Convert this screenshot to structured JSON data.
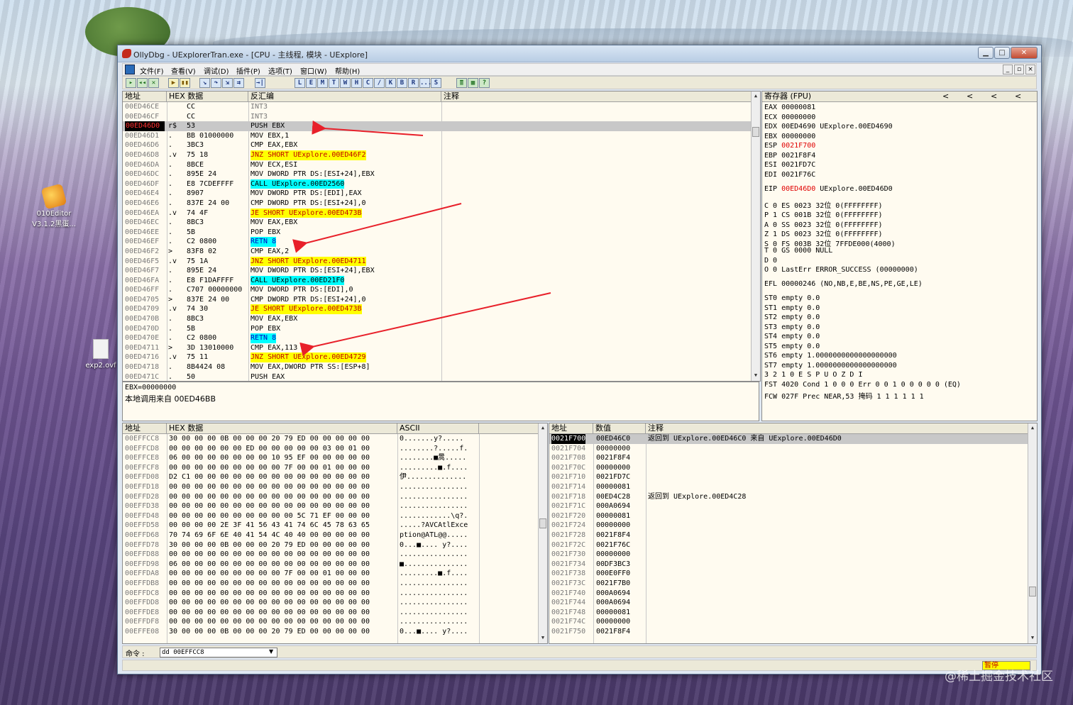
{
  "desktop": {
    "icons": [
      {
        "label_line1": "010Editor",
        "label_line2": "V3.1.2黑蛋..."
      },
      {
        "label_line1": "exp2.ovf",
        "label_line2": ""
      }
    ],
    "watermark": "@稀土掘金技术社区"
  },
  "window": {
    "title": "OllyDbg - UExplorerTran.exe - [CPU - 主线程, 模块 - UExplore]",
    "buttons": {
      "minimize": "▁",
      "maximize": "□",
      "close": "✕"
    },
    "menu": [
      "文件(F)",
      "查看(V)",
      "调试(D)",
      "插件(P)",
      "选项(T)",
      "窗口(W)",
      "帮助(H)"
    ],
    "mdi_buttons": [
      "_",
      "▫",
      "×"
    ],
    "toolbar": [
      "▸",
      "◂◂",
      "✕",
      "▶",
      "▮▮",
      "↘",
      "↷",
      "⇲",
      "⇉",
      "→|",
      "L",
      "E",
      "M",
      "T",
      "W",
      "H",
      "C",
      "/",
      "K",
      "B",
      "R",
      "...",
      "S",
      "≣",
      "▦",
      "?"
    ]
  },
  "cpu": {
    "headers": {
      "address": "地址",
      "hex": "HEX 数据",
      "disasm": "反汇编",
      "comment": "注释"
    },
    "rows": [
      {
        "addr": "00ED46CE",
        "mark": "",
        "hex": "CC",
        "asm": "INT3",
        "style": "dim"
      },
      {
        "addr": "00ED46CF",
        "mark": "",
        "hex": "CC",
        "asm": "INT3",
        "style": "dim"
      },
      {
        "addr": "00ED46D0",
        "mark": "r$",
        "hex": "53",
        "asm": "PUSH EBX",
        "style": "eip"
      },
      {
        "addr": "00ED46D1",
        "mark": ".",
        "hex": "BB 01000000",
        "asm": "MOV EBX,1",
        "style": "plain"
      },
      {
        "addr": "00ED46D6",
        "mark": ".",
        "hex": "3BC3",
        "asm": "CMP EAX,EBX",
        "style": "plain"
      },
      {
        "addr": "00ED46D8",
        "mark": ".v",
        "hex": "75 18",
        "asm": "JNZ SHORT UExplore.00ED46F2",
        "style": "jmp"
      },
      {
        "addr": "00ED46DA",
        "mark": ".",
        "hex": "8BCE",
        "asm": "MOV ECX,ESI",
        "style": "plain"
      },
      {
        "addr": "00ED46DC",
        "mark": ".",
        "hex": "895E 24",
        "asm": "MOV DWORD PTR DS:[ESI+24],EBX",
        "style": "plain"
      },
      {
        "addr": "00ED46DF",
        "mark": ".",
        "hex": "E8 7CDEFFFF",
        "asm": "CALL UExplore.00ED2560",
        "style": "call"
      },
      {
        "addr": "00ED46E4",
        "mark": ".",
        "hex": "8907",
        "asm": "MOV DWORD PTR DS:[EDI],EAX",
        "style": "plain"
      },
      {
        "addr": "00ED46E6",
        "mark": ".",
        "hex": "837E 24 00",
        "asm": "CMP DWORD PTR DS:[ESI+24],0",
        "style": "plain"
      },
      {
        "addr": "00ED46EA",
        "mark": ".v",
        "hex": "74 4F",
        "asm": "JE SHORT UExplore.00ED473B",
        "style": "jmp"
      },
      {
        "addr": "00ED46EC",
        "mark": ".",
        "hex": "8BC3",
        "asm": "MOV EAX,EBX",
        "style": "plain"
      },
      {
        "addr": "00ED46EE",
        "mark": ".",
        "hex": "5B",
        "asm": "POP EBX",
        "style": "plain"
      },
      {
        "addr": "00ED46EF",
        "mark": ".",
        "hex": "C2 0800",
        "asm": "RETN 8",
        "style": "ret"
      },
      {
        "addr": "00ED46F2",
        "mark": ">",
        "hex": "83F8 02",
        "asm": "CMP EAX,2",
        "style": "plain"
      },
      {
        "addr": "00ED46F5",
        "mark": ".v",
        "hex": "75 1A",
        "asm": "JNZ SHORT UExplore.00ED4711",
        "style": "jmp"
      },
      {
        "addr": "00ED46F7",
        "mark": ".",
        "hex": "895E 24",
        "asm": "MOV DWORD PTR DS:[ESI+24],EBX",
        "style": "plain"
      },
      {
        "addr": "00ED46FA",
        "mark": ".",
        "hex": "E8 F1DAFFFF",
        "asm": "CALL UExplore.00ED21F0",
        "style": "call"
      },
      {
        "addr": "00ED46FF",
        "mark": ".",
        "hex": "C707 00000000",
        "asm": "MOV DWORD PTR DS:[EDI],0",
        "style": "plain"
      },
      {
        "addr": "00ED4705",
        "mark": ">",
        "hex": "837E 24 00",
        "asm": "CMP DWORD PTR DS:[ESI+24],0",
        "style": "plain"
      },
      {
        "addr": "00ED4709",
        "mark": ".v",
        "hex": "74 30",
        "asm": "JE SHORT UExplore.00ED473B",
        "style": "jmp"
      },
      {
        "addr": "00ED470B",
        "mark": ".",
        "hex": "8BC3",
        "asm": "MOV EAX,EBX",
        "style": "plain"
      },
      {
        "addr": "00ED470D",
        "mark": ".",
        "hex": "5B",
        "asm": "POP EBX",
        "style": "plain"
      },
      {
        "addr": "00ED470E",
        "mark": ".",
        "hex": "C2 0800",
        "asm": "RETN 8",
        "style": "ret"
      },
      {
        "addr": "00ED4711",
        "mark": ">",
        "hex": "3D 13010000",
        "asm": "CMP EAX,113",
        "style": "plain"
      },
      {
        "addr": "00ED4716",
        "mark": ".v",
        "hex": "75 11",
        "asm": "JNZ SHORT UExplore.00ED4729",
        "style": "jmp"
      },
      {
        "addr": "00ED4718",
        "mark": ".",
        "hex": "8B4424 08",
        "asm": "MOV EAX,DWORD PTR SS:[ESP+8]",
        "style": "plain"
      },
      {
        "addr": "00ED471C",
        "mark": ".",
        "hex": "50",
        "asm": "PUSH EAX",
        "style": "plain"
      }
    ]
  },
  "registers": {
    "header": "寄存器 (FPU)",
    "arrows": [
      "<",
      "<",
      "<",
      "<"
    ],
    "lines": [
      {
        "t": "EAX 00000081"
      },
      {
        "t": "ECX 00000000"
      },
      {
        "t": "EDX 00ED4690 UExplore.00ED4690"
      },
      {
        "t": "EBX 00000000"
      },
      {
        "t": "ESP ",
        "v": "0021F700",
        "r": ""
      },
      {
        "t": "EBP 0021F8F4"
      },
      {
        "t": "ESI 0021FD7C"
      },
      {
        "t": "EDI 0021F76C"
      },
      {
        "t": ""
      },
      {
        "t": "EIP ",
        "v": "00ED46D0",
        "r": " UExplore.00ED46D0"
      },
      {
        "t": ""
      },
      {
        "t": "C 0  ES 0023 32位 0(FFFFFFFF)"
      },
      {
        "t": "P 1  CS 001B 32位 0(FFFFFFFF)"
      },
      {
        "t": "A 0  SS 0023 32位 0(FFFFFFFF)"
      },
      {
        "t": "Z 1  DS 0023 32位 0(FFFFFFFF)"
      },
      {
        "t": "S 0  FS 003B 32位 7FFDE000(4000)"
      },
      {
        "t": "T 0  GS 0000 NULL"
      },
      {
        "t": "D 0"
      },
      {
        "t": "O 0  LastErr ERROR_SUCCESS (00000000)"
      },
      {
        "t": ""
      },
      {
        "t": "EFL 00000246 (NO,NB,E,BE,NS,PE,GE,LE)"
      },
      {
        "t": ""
      },
      {
        "t": "ST0 empty 0.0"
      },
      {
        "t": "ST1 empty 0.0"
      },
      {
        "t": "ST2 empty 0.0"
      },
      {
        "t": "ST3 empty 0.0"
      },
      {
        "t": "ST4 empty 0.0"
      },
      {
        "t": "ST5 empty 0.0"
      },
      {
        "t": "ST6 empty 1.0000000000000000000"
      },
      {
        "t": "ST7 empty 1.0000000000000000000"
      },
      {
        "t": "               3 2 1 0      E S P U O Z D I"
      },
      {
        "t": "FST 4020  Cond 1 0 0 0  Err 0 0 1 0 0 0 0 0  (EQ)"
      },
      {
        "t": "FCW 027F  Prec NEAR,53  掩码    1 1 1 1 1 1"
      }
    ]
  },
  "info": {
    "line1": "EBX=00000000",
    "line2": "本地调用来自 00ED46BB"
  },
  "dump": {
    "headers": {
      "address": "地址",
      "hex": "HEX 数据",
      "ascii": "ASCII"
    },
    "rows": [
      {
        "a": "00EFFCC8",
        "h": "30 00 00 00 0B 00 00 00 20 79 ED 00 00 00 00 00",
        "s": "0.......y?....."
      },
      {
        "a": "00EFFCD8",
        "h": "00 00 00 00 00 00 ED 00 00 00 00 00 03 00 01 00",
        "s": "........?.....f."
      },
      {
        "a": "00EFFCE8",
        "h": "06 00 00 00 00 00 00 00 10 95 EF 00 00 00 00 00",
        "s": "........■暠....."
      },
      {
        "a": "00EFFCF8",
        "h": "00 00 00 00 00 00 00 00 00 7F 00 00 01 00 00 00",
        "s": ".........■.f...."
      },
      {
        "a": "00EFFD08",
        "h": "D2 C1 00 00 00 00 00 00 00 00 00 00 00 00 00 00",
        "s": "伊.............."
      },
      {
        "a": "00EFFD18",
        "h": "00 00 00 00 00 00 00 00 00 00 00 00 00 00 00 00",
        "s": "................"
      },
      {
        "a": "00EFFD28",
        "h": "00 00 00 00 00 00 00 00 00 00 00 00 00 00 00 00",
        "s": "................"
      },
      {
        "a": "00EFFD38",
        "h": "00 00 00 00 00 00 00 00 00 00 00 00 00 00 00 00",
        "s": "................"
      },
      {
        "a": "00EFFD48",
        "h": "00 00 00 00 00 00 00 00 00 00 5C 71 EF 00 00 00",
        "s": "............\\q?."
      },
      {
        "a": "00EFFD58",
        "h": "00 00 00 00 2E 3F 41 56 43 41 74 6C 45 78 63 65",
        "s": ".....?AVCAtlExce"
      },
      {
        "a": "00EFFD68",
        "h": "70 74 69 6F 6E 40 41 54 4C 40 40 00 00 00 00 00",
        "s": "ption@ATL@@....."
      },
      {
        "a": "00EFFD78",
        "h": "30 00 00 00 0B 00 00 00 20 79 ED 00 00 00 00 00",
        "s": "0...■.... y?...."
      },
      {
        "a": "00EFFD88",
        "h": "00 00 00 00 00 00 00 00 00 00 00 00 00 00 00 00",
        "s": "................"
      },
      {
        "a": "00EFFD98",
        "h": "06 00 00 00 00 00 00 00 00 00 00 00 00 00 00 00",
        "s": "■..............."
      },
      {
        "a": "00EFFDA8",
        "h": "00 00 00 00 00 00 00 00 00 7F 00 00 01 00 00 00",
        "s": ".........■.f...."
      },
      {
        "a": "00EFFDB8",
        "h": "00 00 00 00 00 00 00 00 00 00 00 00 00 00 00 00",
        "s": "................"
      },
      {
        "a": "00EFFDC8",
        "h": "00 00 00 00 00 00 00 00 00 00 00 00 00 00 00 00",
        "s": "................"
      },
      {
        "a": "00EFFDD8",
        "h": "00 00 00 00 00 00 00 00 00 00 00 00 00 00 00 00",
        "s": "................"
      },
      {
        "a": "00EFFDE8",
        "h": "00 00 00 00 00 00 00 00 00 00 00 00 00 00 00 00",
        "s": "................"
      },
      {
        "a": "00EFFDF8",
        "h": "00 00 00 00 00 00 00 00 00 00 00 00 00 00 00 00",
        "s": "................"
      },
      {
        "a": "00EFFE08",
        "h": "30 00 00 00 0B 00 00 00 20 79 ED 00 00 00 00 00",
        "s": "0...■.... y?...."
      }
    ]
  },
  "stack": {
    "headers": {
      "address": "地址",
      "value": "数值",
      "comment": "注释"
    },
    "rows": [
      {
        "a": "0021F700",
        "v": "00ED46C0",
        "c": "返回到 UExplore.00ED46C0 来自 UExplore.00ED46D0",
        "sel": true
      },
      {
        "a": "0021F704",
        "v": "00000000",
        "c": ""
      },
      {
        "a": "0021F708",
        "v": "0021F8F4",
        "c": ""
      },
      {
        "a": "0021F70C",
        "v": "00000000",
        "c": ""
      },
      {
        "a": "0021F710",
        "v": "0021FD7C",
        "c": ""
      },
      {
        "a": "0021F714",
        "v": "00000081",
        "c": ""
      },
      {
        "a": "0021F718",
        "v": "00ED4C28",
        "c": "返回到 UExplore.00ED4C28"
      },
      {
        "a": "0021F71C",
        "v": "000A0694",
        "c": ""
      },
      {
        "a": "0021F720",
        "v": "00000081",
        "c": ""
      },
      {
        "a": "0021F724",
        "v": "00000000",
        "c": ""
      },
      {
        "a": "0021F728",
        "v": "0021F8F4",
        "c": ""
      },
      {
        "a": "0021F72C",
        "v": "0021F76C",
        "c": ""
      },
      {
        "a": "0021F730",
        "v": "00000000",
        "c": ""
      },
      {
        "a": "0021F734",
        "v": "00DF3BC3",
        "c": ""
      },
      {
        "a": "0021F738",
        "v": "000E0FF0",
        "c": ""
      },
      {
        "a": "0021F73C",
        "v": "0021F7B0",
        "c": ""
      },
      {
        "a": "0021F740",
        "v": "000A0694",
        "c": ""
      },
      {
        "a": "0021F744",
        "v": "000A0694",
        "c": ""
      },
      {
        "a": "0021F748",
        "v": "00000081",
        "c": ""
      },
      {
        "a": "0021F74C",
        "v": "00000000",
        "c": ""
      },
      {
        "a": "0021F750",
        "v": "0021F8F4",
        "c": ""
      }
    ]
  },
  "command": {
    "label": "命令 :",
    "value": "dd 00EFFCC8"
  },
  "status": {
    "paused": "暂停"
  },
  "colors": {
    "annotation_arrow": "#e8202a",
    "eip_bg": "#000000",
    "eip_fg": "#ff3030",
    "call_bg": "#00ffff",
    "jmp_bg": "#ffff00"
  }
}
